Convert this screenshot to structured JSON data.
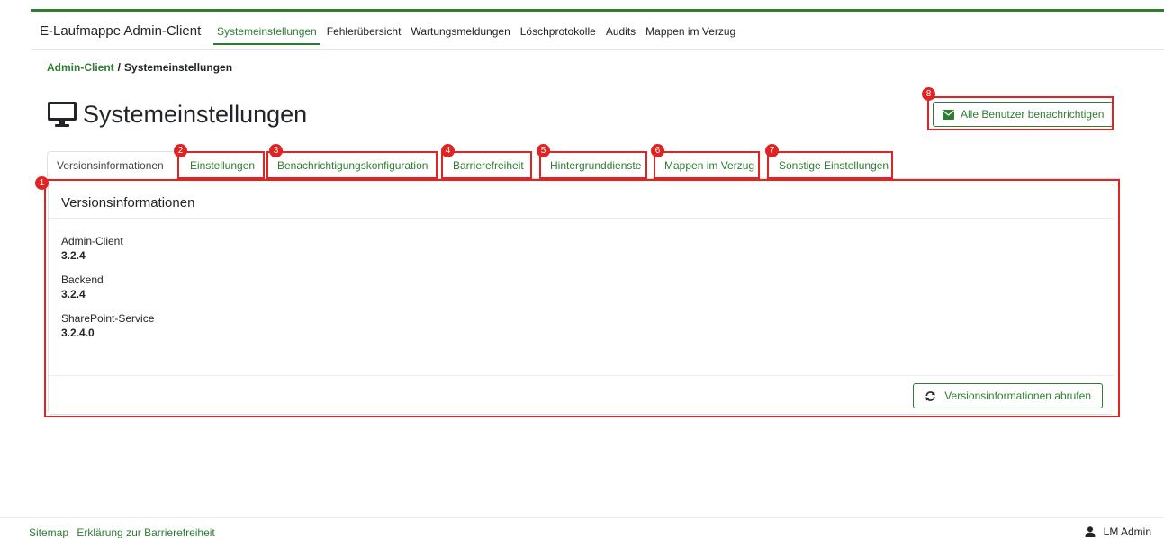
{
  "navbar": {
    "brand": "E-Laufmappe Admin-Client",
    "links": [
      "Systemeinstellungen",
      "Fehlerübersicht",
      "Wartungsmeldungen",
      "Löschprotokolle",
      "Audits",
      "Mappen im Verzug"
    ],
    "active_index": 0
  },
  "breadcrumb": {
    "root": "Admin-Client",
    "separator": "/",
    "current": "Systemeinstellungen"
  },
  "page": {
    "title": "Systemeinstellungen",
    "icon": "monitor-icon"
  },
  "notify_button": {
    "label": "Alle Benutzer benachrichtigen",
    "icon": "envelope-icon"
  },
  "tabs": [
    "Versionsinformationen",
    "Einstellungen",
    "Benachrichtigungskonfiguration",
    "Barrierefreiheit",
    "Hintergrunddienste",
    "Mappen im Verzug",
    "Sonstige Einstellungen"
  ],
  "card": {
    "title": "Versionsinformationen",
    "items": [
      {
        "label": "Admin-Client",
        "value": "3.2.4"
      },
      {
        "label": "Backend",
        "value": "3.2.4"
      },
      {
        "label": "SharePoint-Service",
        "value": "3.2.4.0"
      }
    ],
    "fetch_button": {
      "label": "Versionsinformationen abrufen",
      "icon": "refresh-icon"
    }
  },
  "annotations": [
    "1",
    "2",
    "3",
    "4",
    "5",
    "6",
    "7",
    "8"
  ],
  "footer": {
    "links": [
      "Sitemap",
      "Erklärung zur Barrierefreiheit"
    ],
    "user": "LM Admin"
  },
  "colors": {
    "accent": "#2e7d32",
    "highlight": "#e02424"
  }
}
